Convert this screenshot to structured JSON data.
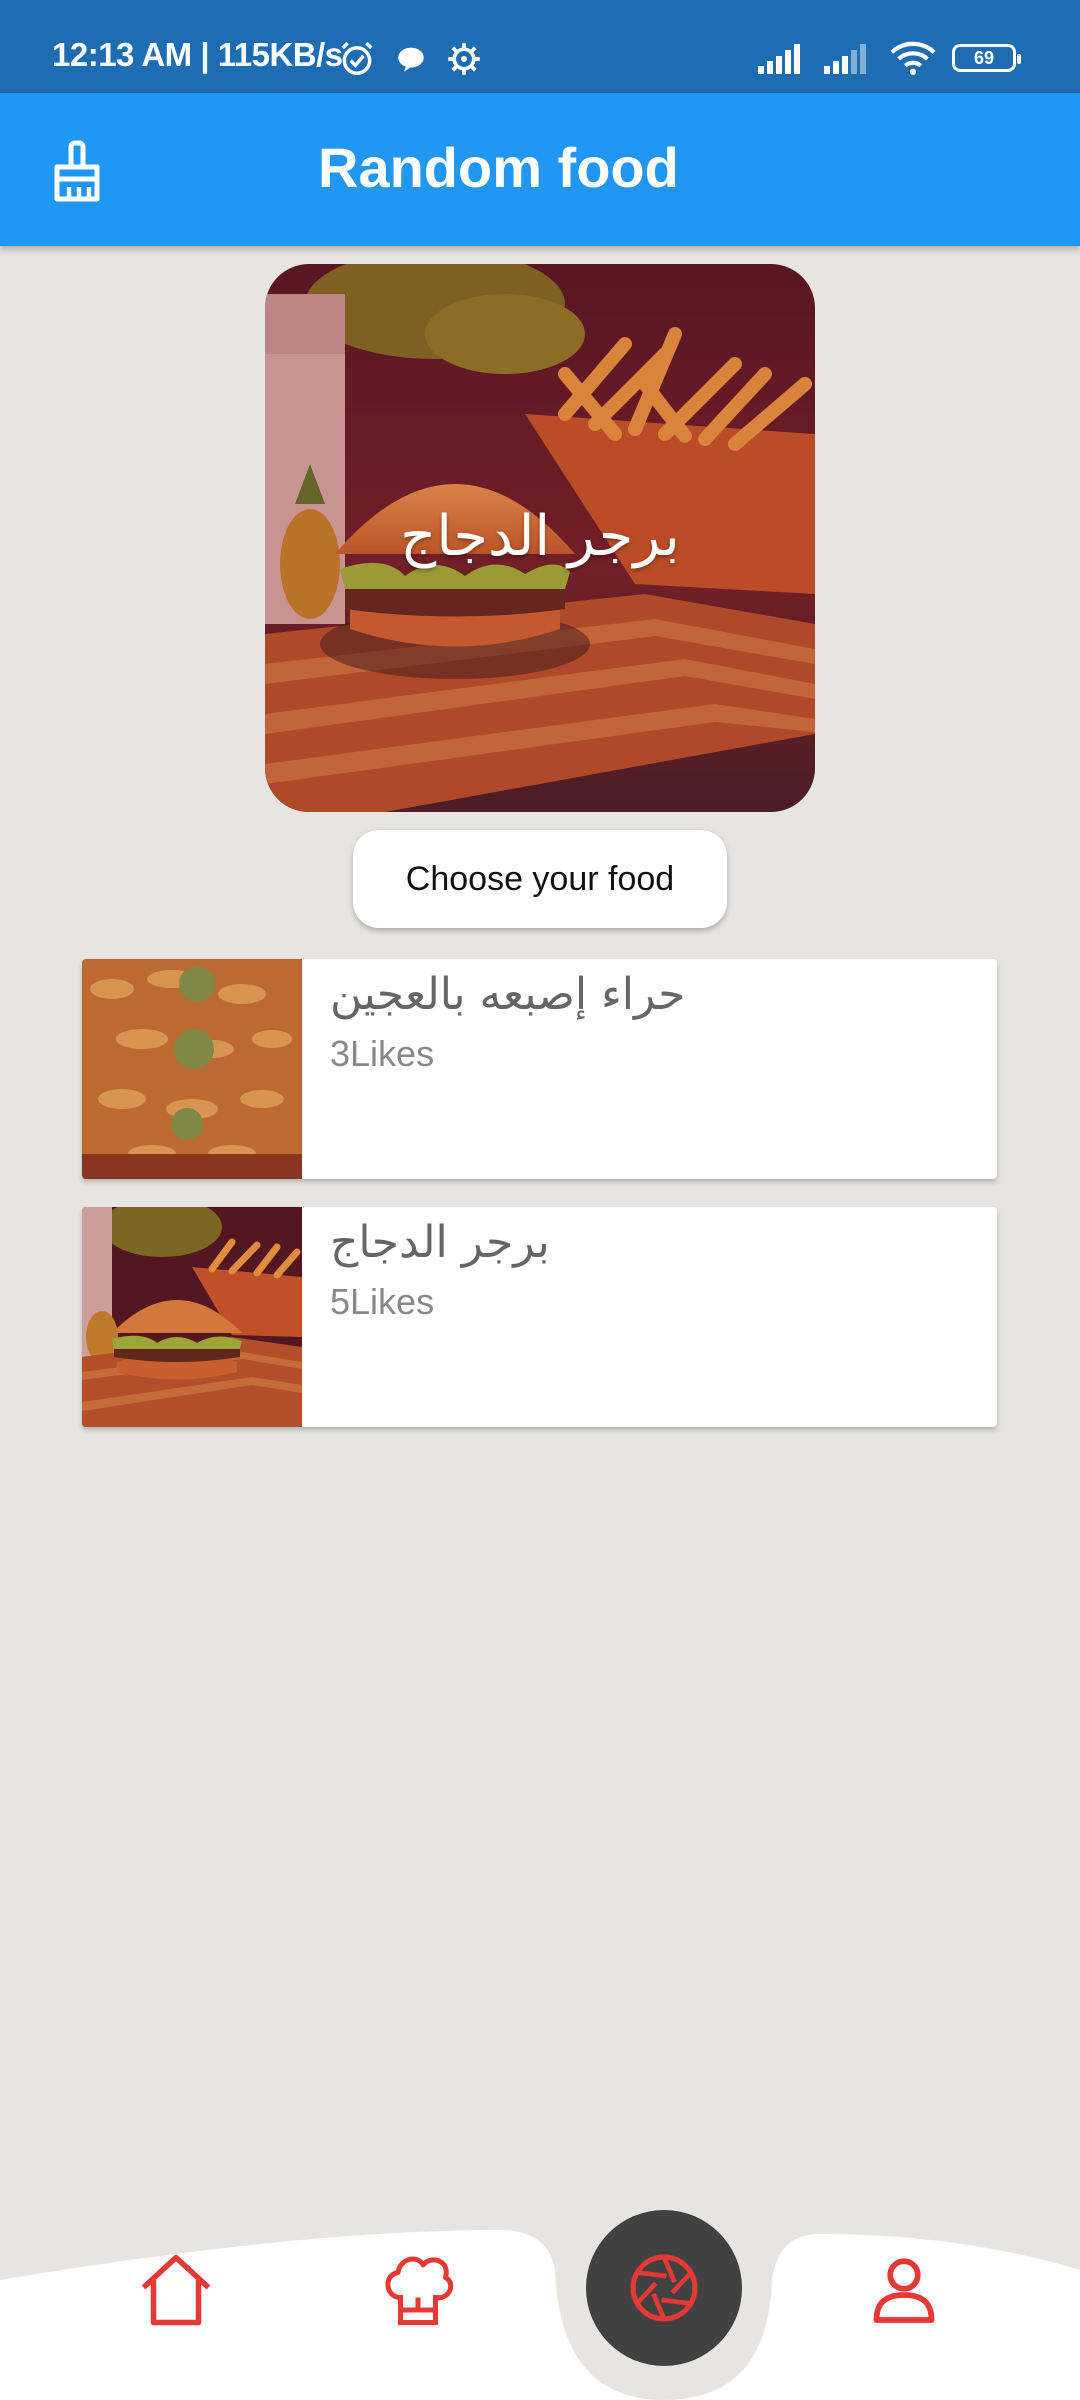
{
  "status_bar": {
    "time_speed": "12:13 AM | 115KB/s",
    "battery": "69"
  },
  "app_bar": {
    "title": "Random food",
    "left_icon": "broom-icon"
  },
  "hero": {
    "title": "برجر الدجاج"
  },
  "choose_button": {
    "label": "Choose your food"
  },
  "food_list": [
    {
      "name": "حراء إصبعه بالعجين",
      "likes": "3Likes"
    },
    {
      "name": "برجر الدجاج",
      "likes": "5Likes"
    }
  ],
  "bottom_nav": {
    "items": [
      "home-icon",
      "chef-hat-icon",
      "shutter-icon",
      "profile-icon"
    ]
  },
  "colors": {
    "status_bar": "#1e6db3",
    "app_bar": "#2196f3",
    "accent": "#e53935",
    "background": "#e6e5e2",
    "center_button": "#414141"
  }
}
